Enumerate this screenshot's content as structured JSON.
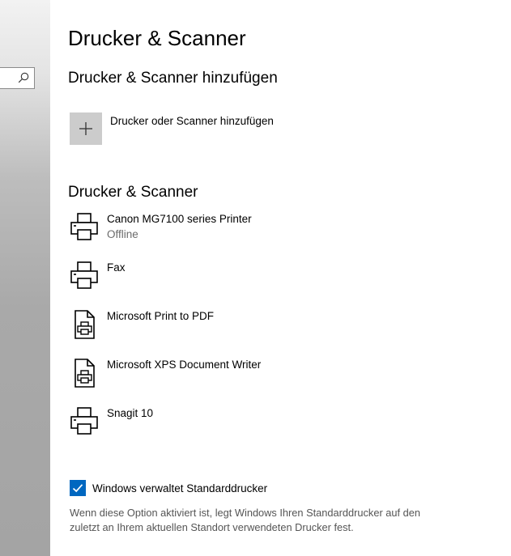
{
  "page": {
    "title": "Drucker & Scanner"
  },
  "add_section": {
    "heading": "Drucker & Scanner hinzufügen",
    "add_button_label": "Drucker oder Scanner hinzufügen",
    "add_icon": "plus-icon"
  },
  "devices_section": {
    "heading": "Drucker & Scanner",
    "devices": [
      {
        "name": "Canon MG7100 series Printer",
        "status": "Offline",
        "icon": "printer-icon"
      },
      {
        "name": "Fax",
        "status": "",
        "icon": "printer-icon"
      },
      {
        "name": "Microsoft Print to PDF",
        "status": "",
        "icon": "document-printer-icon"
      },
      {
        "name": "Microsoft XPS Document Writer",
        "status": "",
        "icon": "document-printer-icon"
      },
      {
        "name": "Snagit 10",
        "status": "",
        "icon": "printer-icon"
      }
    ]
  },
  "default_printer": {
    "checked": true,
    "label": "Windows verwaltet Standarddrucker",
    "description": "Wenn diese Option aktiviert ist, legt Windows Ihren Standarddrucker auf den zuletzt an Ihrem aktuellen Standort verwendeten Drucker fest."
  },
  "sidebar": {
    "search_icon": "search-icon"
  },
  "colors": {
    "accent": "#0067c0",
    "add_tile": "#cccccc",
    "secondary_text": "#6b6b6b"
  }
}
